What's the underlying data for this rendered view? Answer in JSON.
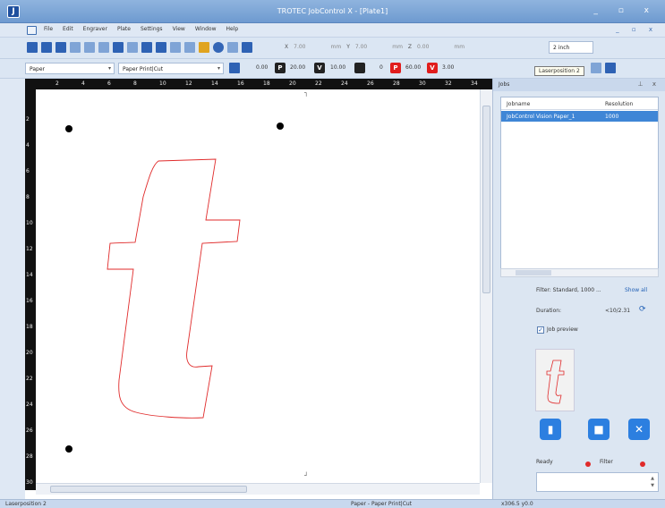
{
  "window": {
    "title": "TROTEC JobControl X - [Plate1]"
  },
  "menu": [
    "File",
    "Edit",
    "Engraver",
    "Plate",
    "Settings",
    "View",
    "Window",
    "Help"
  ],
  "toolbar": {
    "x_label": "X",
    "x_value": "7.00",
    "x_unit": "mm",
    "y_label": "Y",
    "y_value": "7.00",
    "y_unit": "mm",
    "z_label": "Z",
    "z_value": "0.00",
    "z_unit": "mm",
    "size_value": "2 inch"
  },
  "params": {
    "material_group": "Paper",
    "material": "Paper Print|Cut",
    "v1": "0.00",
    "p_label": "P",
    "p_value": "20.00",
    "v_label": "V",
    "v_value": "10.00",
    "ppi_value": "0",
    "p2_label": "P",
    "p2_value": "60.00",
    "v2_label": "V",
    "v2_value": "3.00"
  },
  "tooltip": "Laserposition 2",
  "ruler": {
    "top": [
      "2",
      "4",
      "6",
      "8",
      "10",
      "12",
      "14",
      "16",
      "18",
      "20",
      "22",
      "24",
      "26",
      "28",
      "30",
      "32",
      "34"
    ],
    "left": [
      "2",
      "4",
      "6",
      "8",
      "10",
      "12",
      "14",
      "16",
      "18",
      "20",
      "22",
      "24",
      "26",
      "28",
      "30"
    ]
  },
  "jobs": {
    "panel_title": "Jobs",
    "col_name": "Jobname",
    "col_res": "Resolution",
    "rows": [
      {
        "name": "JobControl Vision Paper_1",
        "res": "1000"
      }
    ],
    "filter": "Filter: Standard, 1000 ...",
    "show_all": "Show all",
    "duration_label": "Duration:",
    "duration_value": "<10/2.31",
    "job_preview_label": "Job preview",
    "ready_label": "Ready",
    "filter_label": "Filter"
  },
  "status": {
    "left": "Laserposition 2",
    "material": "Paper - Paper Print|Cut",
    "coords": "x306.5 y0.0"
  },
  "colors": {
    "cut_line": "#e02a2a",
    "accent": "#3f86d6"
  }
}
